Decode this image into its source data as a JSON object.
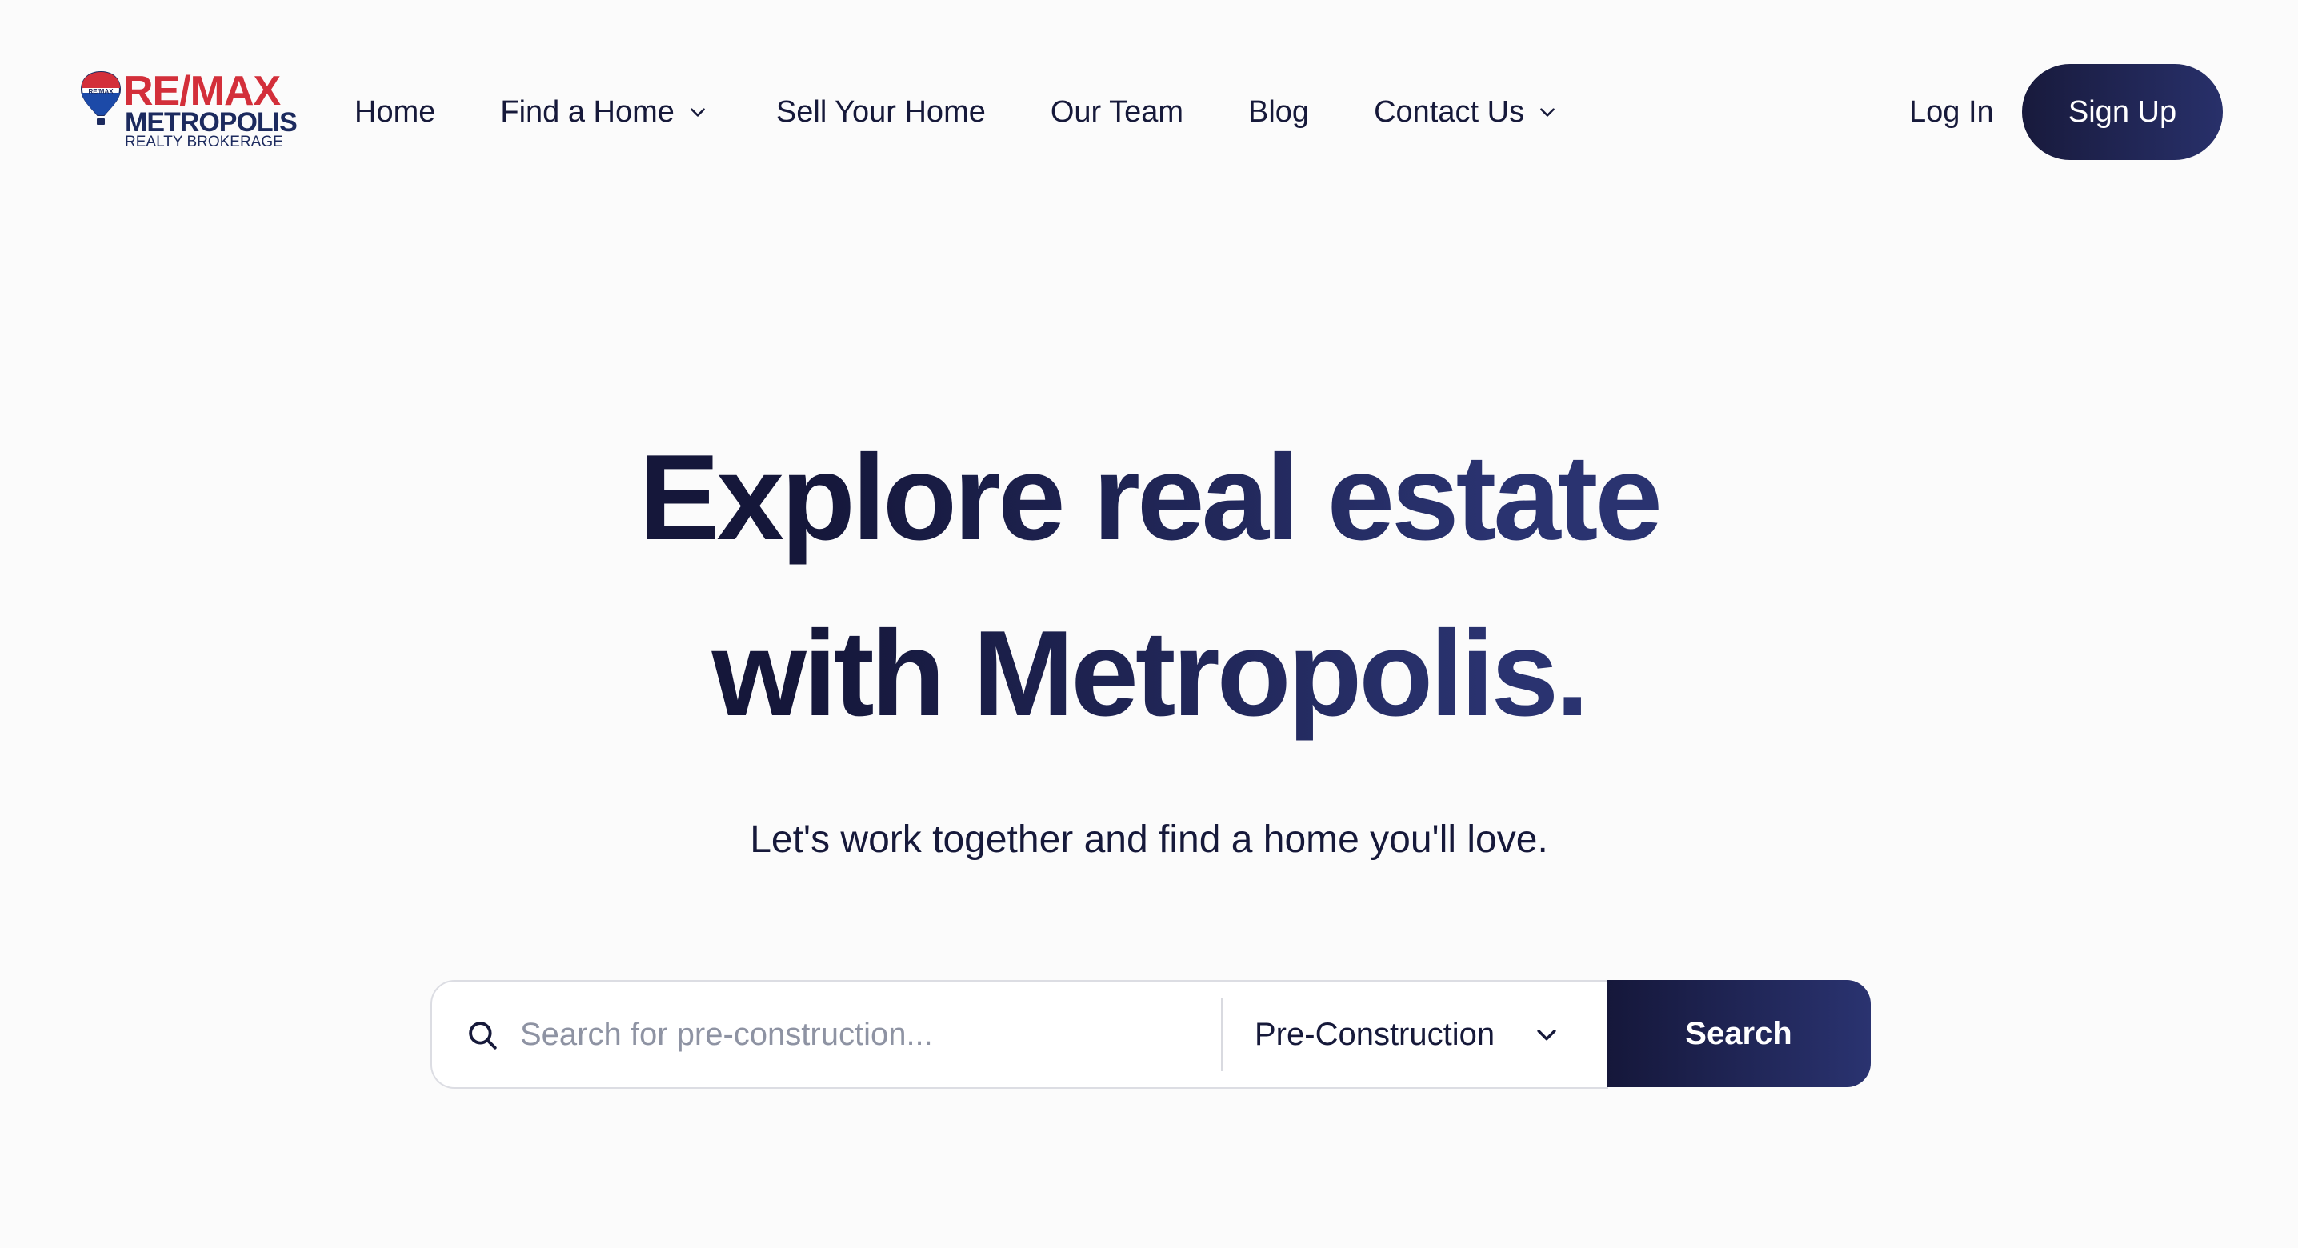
{
  "brand": {
    "logo_text": "RE/MAX",
    "name": "METROPOLIS",
    "subtitle": "REALTY BROKERAGE",
    "balloon_text": "RE/MAX",
    "colors": {
      "red": "#d32f3a",
      "navy": "#1c2a5e"
    }
  },
  "nav": {
    "items": [
      {
        "label": "Home",
        "has_dropdown": false
      },
      {
        "label": "Find a Home",
        "has_dropdown": true
      },
      {
        "label": "Sell Your Home",
        "has_dropdown": false
      },
      {
        "label": "Our Team",
        "has_dropdown": false
      },
      {
        "label": "Blog",
        "has_dropdown": false
      },
      {
        "label": "Contact Us",
        "has_dropdown": true
      }
    ],
    "login_label": "Log In",
    "signup_label": "Sign Up"
  },
  "hero": {
    "title_line1": "Explore real estate",
    "title_line2": "with Metropolis.",
    "subtitle": "Let's work together and find a home you'll love."
  },
  "search": {
    "input_value": "",
    "placeholder": "Search for pre-construction...",
    "selected_type": "Pre-Construction",
    "button_label": "Search",
    "icons": {
      "search": "search-icon",
      "dropdown": "chevron-down-icon"
    }
  },
  "theme": {
    "background": "#fbfbfb",
    "text": "#16193a",
    "accent_start": "#15173a",
    "accent_end": "#2a3370",
    "placeholder": "#8e93a3",
    "border": "#dcdde3"
  }
}
